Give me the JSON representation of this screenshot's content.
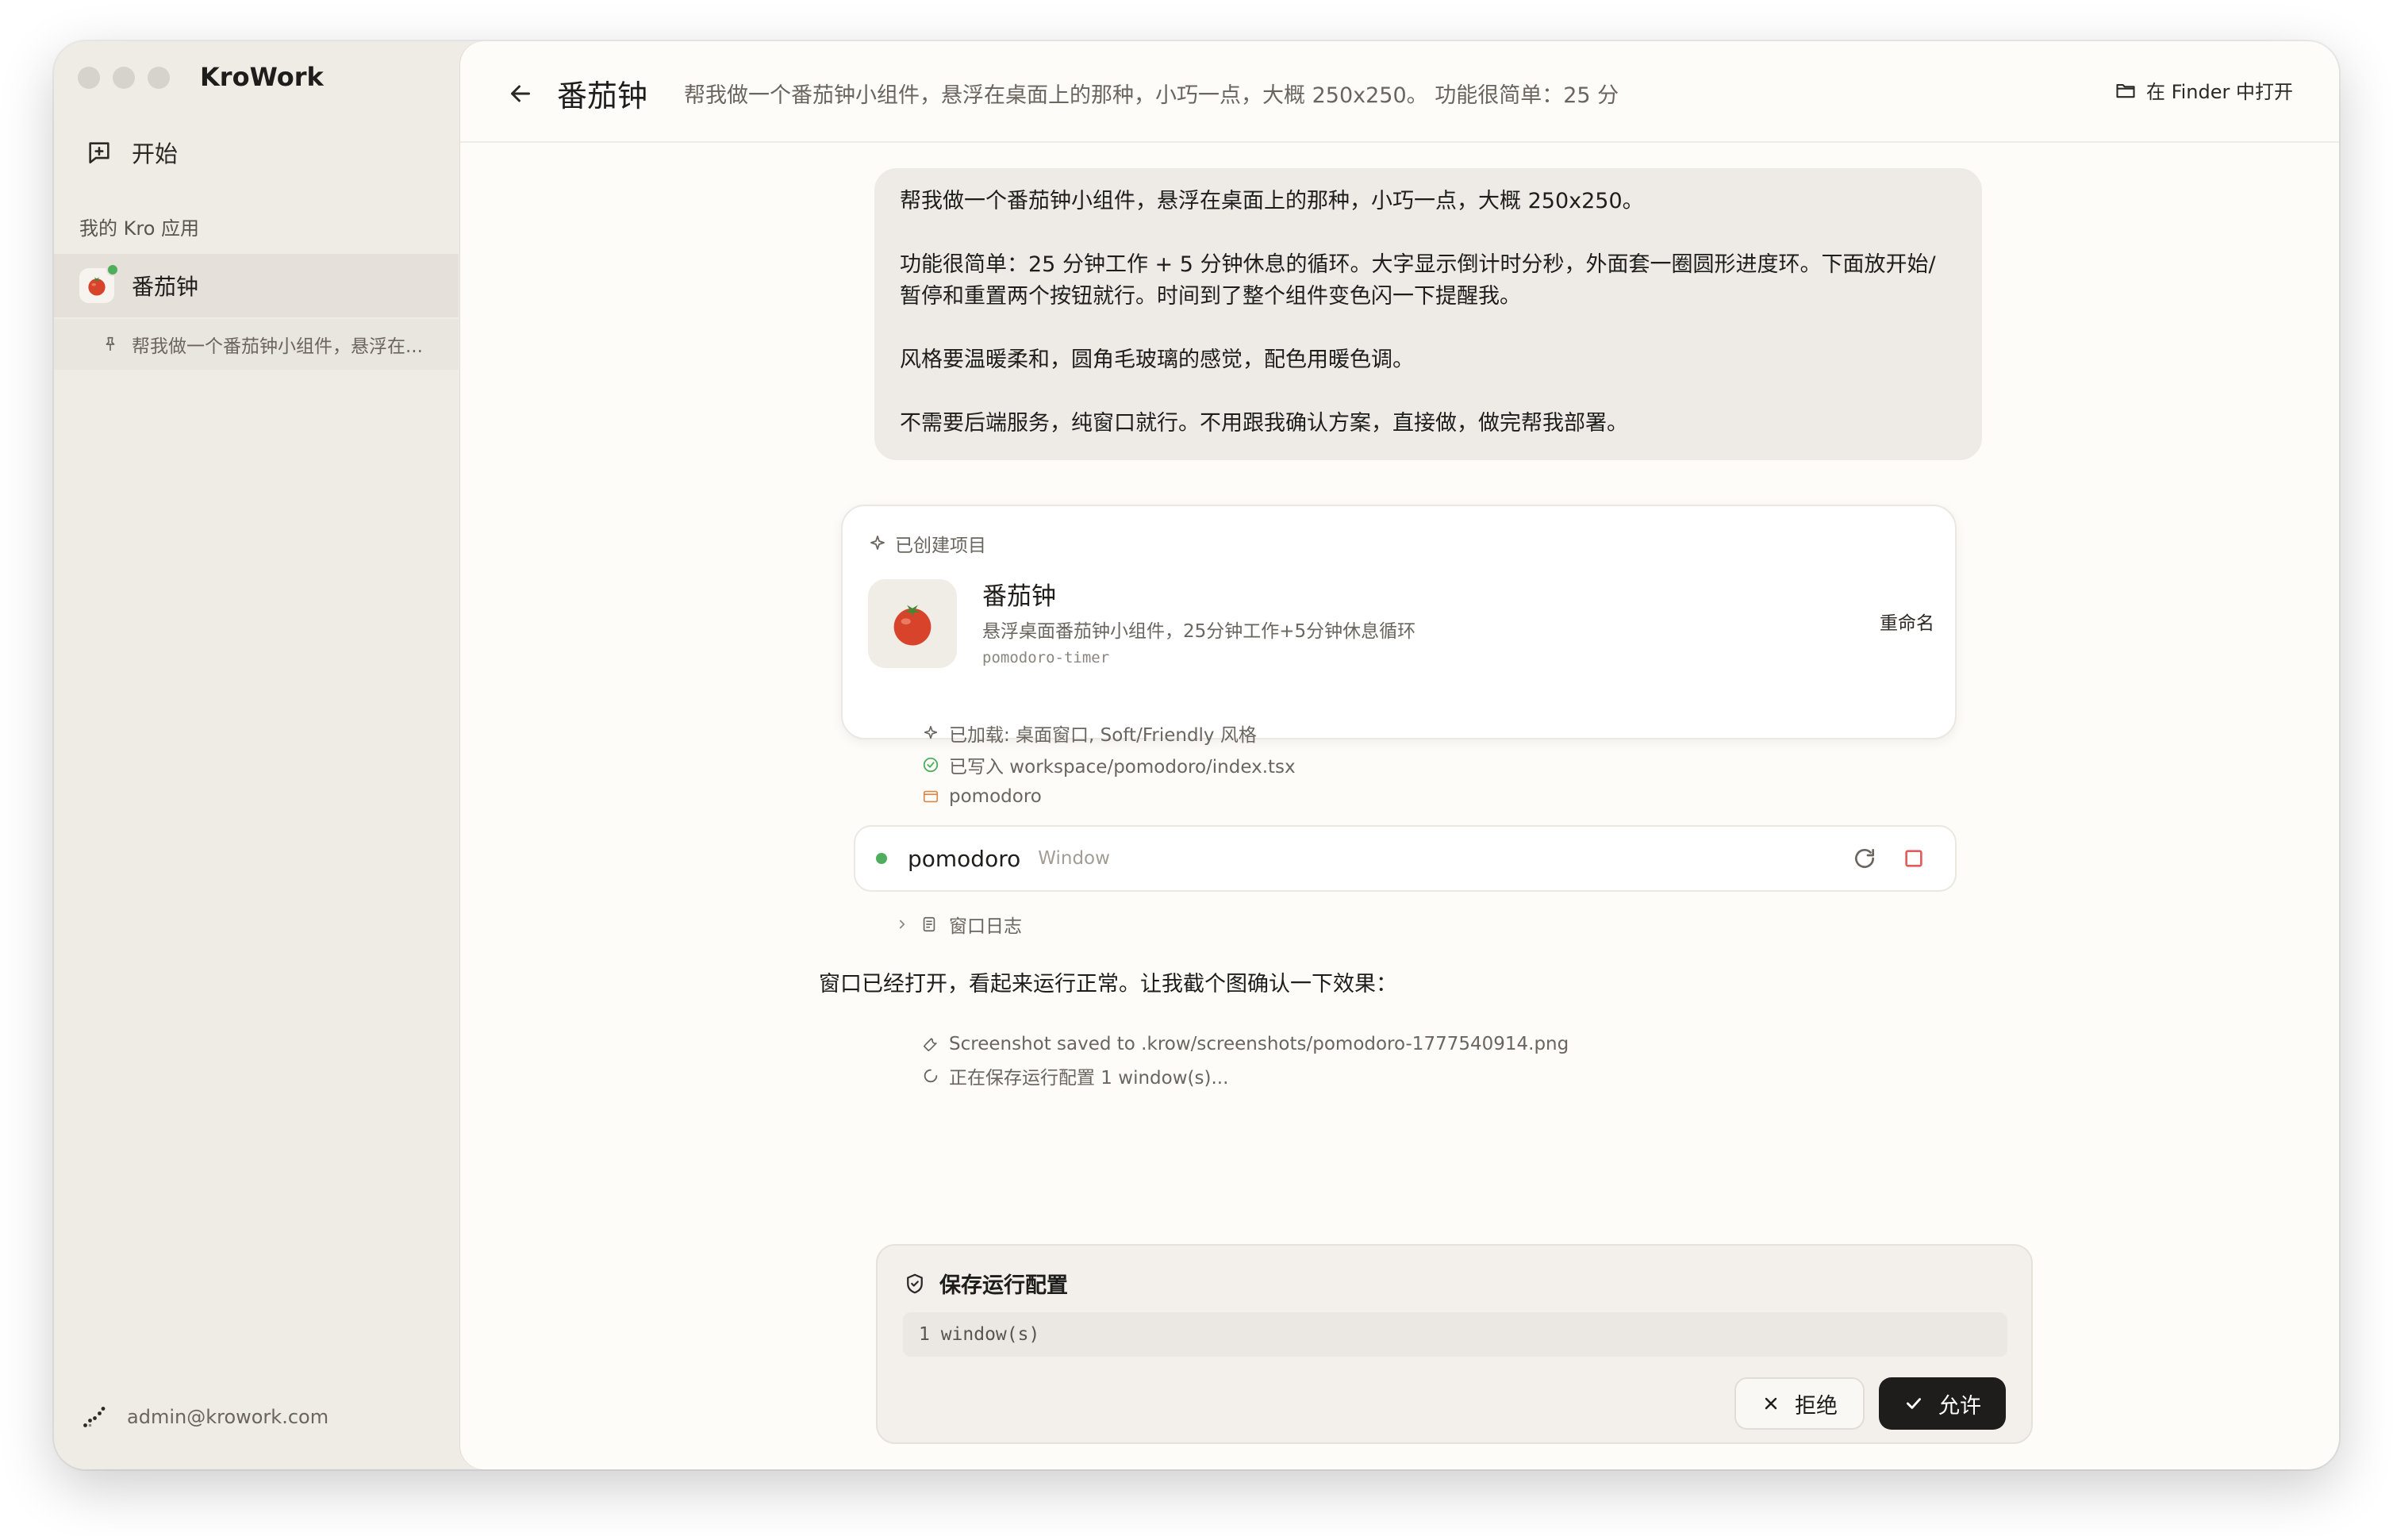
{
  "app": {
    "name": "KroWork"
  },
  "sidebar": {
    "new_label": "开始",
    "section_label": "我的 Kro 应用",
    "apps": [
      {
        "label": "番茄钟",
        "status_color": "#4fae5c"
      }
    ],
    "threads": [
      {
        "label": "帮我做一个番茄钟小组件，悬浮在..."
      }
    ],
    "user": {
      "email": "admin@krowork.com"
    }
  },
  "header": {
    "title": "番茄钟",
    "subtitle": "帮我做一个番茄钟小组件，悬浮在桌面上的那种，小巧一点，大概 250x250。 功能很简单：25 分",
    "finder_label": "在 Finder 中打开"
  },
  "conversation": {
    "user_message": [
      "帮我做一个番茄钟小组件，悬浮在桌面上的那种，小巧一点，大概 250x250。",
      "功能很简单：25 分钟工作 + 5 分钟休息的循环。大字显示倒计时分秒，外面套一圈圆形进度环。下面放开始/暂停和重置两个按钮就行。时间到了整个组件变色闪一下提醒我。",
      "风格要温暖柔和，圆角毛玻璃的感觉，配色用暖色调。",
      "不需要后端服务，纯窗口就行。不用跟我确认方案，直接做，做完帮我部署。"
    ],
    "project_card": {
      "heading": "已创建项目",
      "title": "番茄钟",
      "description": "悬浮桌面番茄钟小组件，25分钟工作+5分钟休息循环",
      "slug": "pomodoro-timer",
      "rename_label": "重命名"
    },
    "status_lines": {
      "loaded": "已加载: 桌面窗口, Soft/Friendly 风格",
      "written": "已写入 workspace/pomodoro/index.tsx",
      "folder": "pomodoro"
    },
    "window_card": {
      "name": "pomodoro",
      "kind": "Window",
      "status_color": "#4fae5c"
    },
    "log_toggle_label": "窗口日志",
    "assistant_text": "窗口已经打开，看起来运行正常。让我截个图确认一下效果：",
    "tool_lines": {
      "screenshot": "Screenshot saved to .krow/screenshots/pomodoro-1777540914.png",
      "saving": "正在保存运行配置 1 window(s)..."
    }
  },
  "dialog": {
    "permission": {
      "title": "保存运行配置",
      "code": "1 window(s)",
      "deny_label": "拒绝",
      "allow_label": "允许"
    }
  },
  "colors": {
    "accent_dark": "#1f1d1b",
    "success": "#4fae5c",
    "stop": "#e25c5c"
  }
}
